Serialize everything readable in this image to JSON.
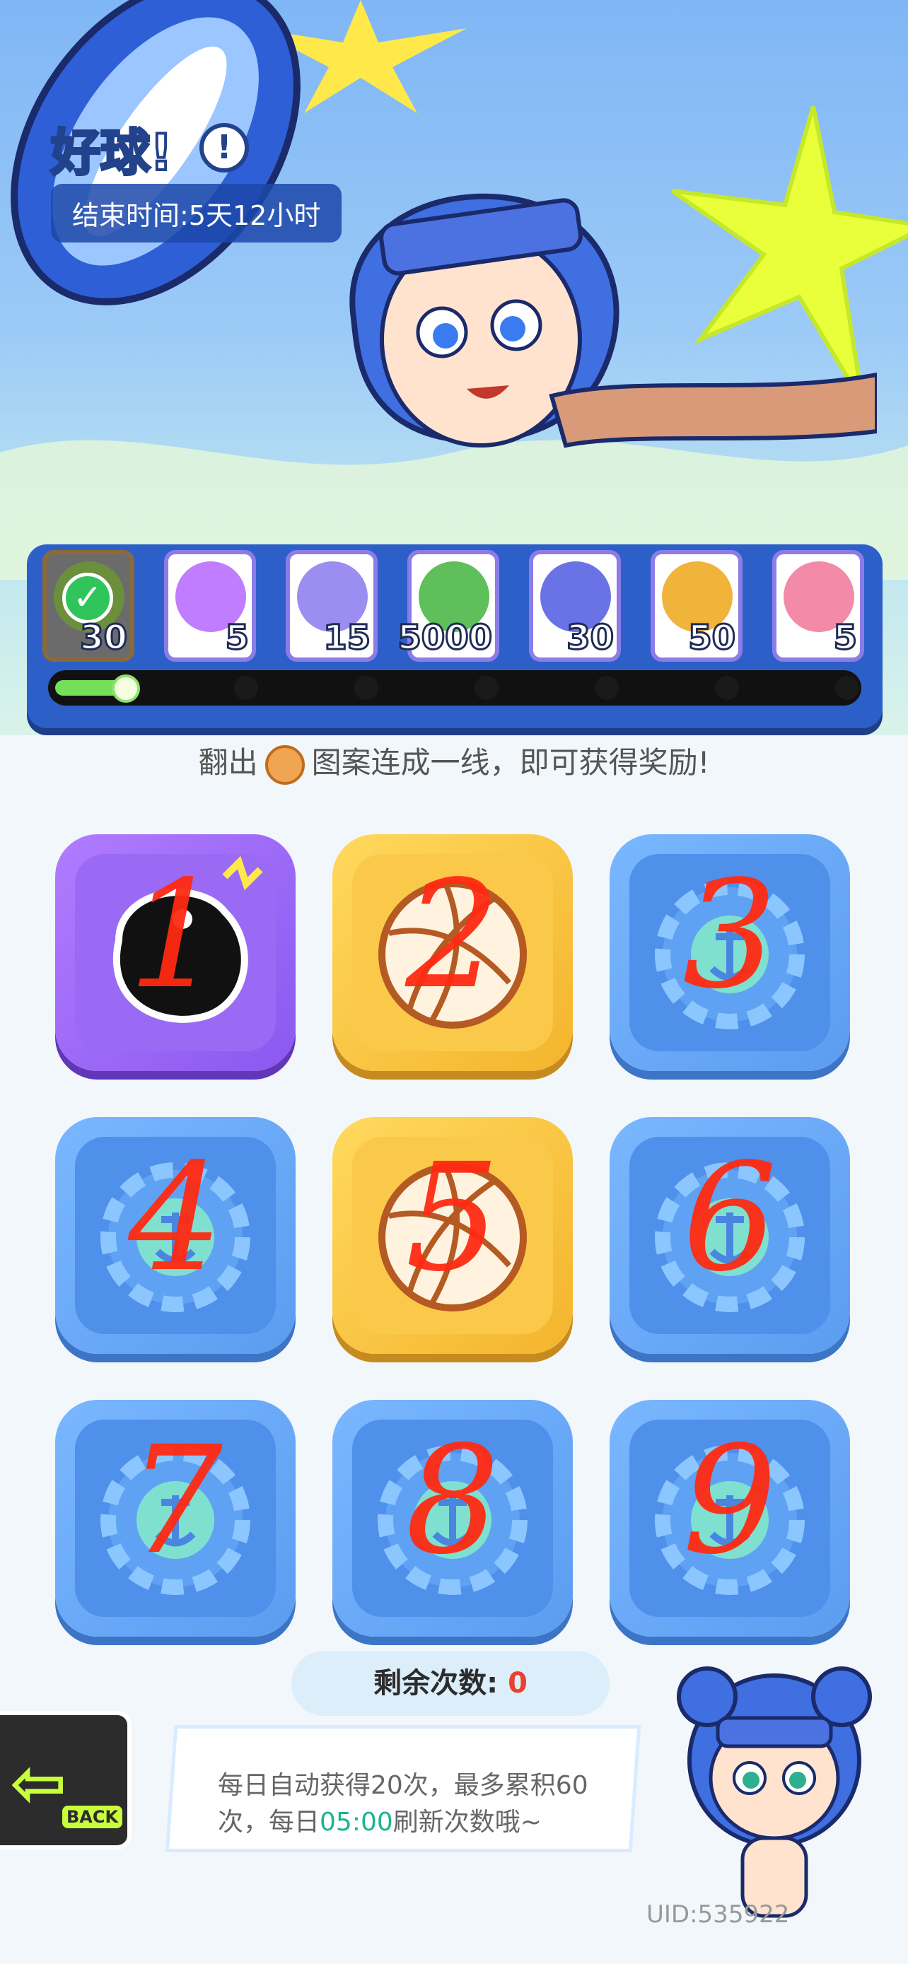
{
  "event": {
    "title_first": "好",
    "title_rest": "球!",
    "info_icon": "!",
    "end_time": "结束时间:5天12小时"
  },
  "rewards": [
    {
      "count": "30",
      "claimed": true,
      "icon": "jar-icon",
      "color": "#6b8f3a"
    },
    {
      "count": "5",
      "claimed": false,
      "icon": "flame-icon",
      "color": "#c07dff"
    },
    {
      "count": "15",
      "claimed": false,
      "icon": "cool-can-icon",
      "color": "#9b8ef0"
    },
    {
      "count": "5000",
      "claimed": false,
      "icon": "cash-icon",
      "color": "#5fbf5a"
    },
    {
      "count": "30",
      "claimed": false,
      "icon": "card-pack-icon",
      "color": "#6a73e6"
    },
    {
      "count": "50",
      "claimed": false,
      "icon": "paint-jar-icon",
      "color": "#f0b43a"
    },
    {
      "count": "5",
      "claimed": false,
      "icon": "sticker-icon",
      "color": "#f28aa8"
    }
  ],
  "progress": {
    "filled_nodes": 1,
    "total_nodes": 7
  },
  "hint": {
    "before": "翻出",
    "after": "图案连成一线，即可获得奖励!"
  },
  "grid": [
    {
      "num": "1",
      "type": "purple",
      "icon": "ink-blob-icon"
    },
    {
      "num": "2",
      "type": "gold",
      "icon": "volleyball-icon"
    },
    {
      "num": "3",
      "type": "blue",
      "icon": "anchor-wheel-icon"
    },
    {
      "num": "4",
      "type": "blue",
      "icon": "anchor-wheel-icon"
    },
    {
      "num": "5",
      "type": "gold",
      "icon": "volleyball-icon"
    },
    {
      "num": "6",
      "type": "blue",
      "icon": "anchor-wheel-icon"
    },
    {
      "num": "7",
      "type": "blue",
      "icon": "anchor-wheel-icon"
    },
    {
      "num": "8",
      "type": "blue",
      "icon": "anchor-wheel-icon"
    },
    {
      "num": "9",
      "type": "blue",
      "icon": "anchor-wheel-icon"
    }
  ],
  "remaining": {
    "label": "剩余次数:",
    "value": "0"
  },
  "back": {
    "label": "BACK"
  },
  "info": {
    "line1": "每日自动获得20次，最多累积60",
    "line2_prefix": "次，每日",
    "line2_time": "05:00",
    "line2_suffix": "刷新次数哦~"
  },
  "uid": "UID:535922"
}
